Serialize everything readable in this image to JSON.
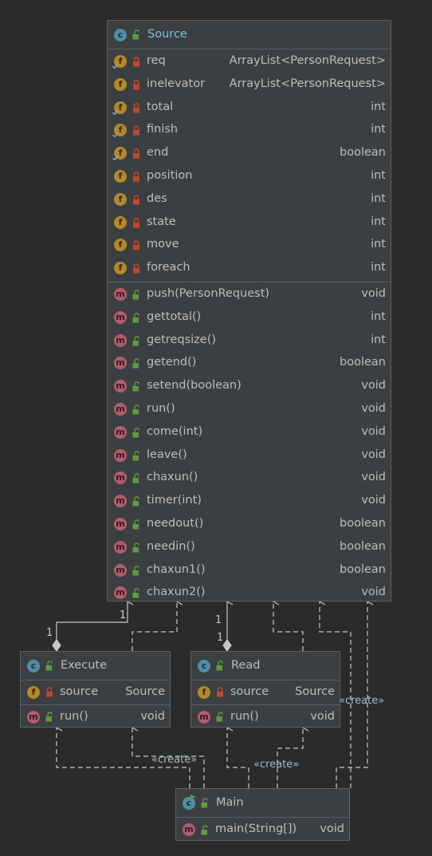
{
  "classes": {
    "source": {
      "title": "Source",
      "fields": [
        {
          "name": "req",
          "type": "ArrayList<PersonRequest>",
          "final": true
        },
        {
          "name": "inelevator",
          "type": "ArrayList<PersonRequest>",
          "final": false
        },
        {
          "name": "total",
          "type": "int",
          "final": true
        },
        {
          "name": "finish",
          "type": "int",
          "final": true
        },
        {
          "name": "end",
          "type": "boolean",
          "final": true
        },
        {
          "name": "position",
          "type": "int",
          "final": false
        },
        {
          "name": "des",
          "type": "int",
          "final": false
        },
        {
          "name": "state",
          "type": "int",
          "final": false
        },
        {
          "name": "move",
          "type": "int",
          "final": false
        },
        {
          "name": "foreach",
          "type": "int",
          "final": false
        }
      ],
      "methods": [
        {
          "name": "push(PersonRequest)",
          "type": "void"
        },
        {
          "name": "gettotal()",
          "type": "int"
        },
        {
          "name": "getreqsize()",
          "type": "int"
        },
        {
          "name": "getend()",
          "type": "boolean"
        },
        {
          "name": "setend(boolean)",
          "type": "void"
        },
        {
          "name": "run()",
          "type": "void"
        },
        {
          "name": "come(int)",
          "type": "void"
        },
        {
          "name": "leave()",
          "type": "void"
        },
        {
          "name": "chaxun()",
          "type": "void"
        },
        {
          "name": "timer(int)",
          "type": "void"
        },
        {
          "name": "needout()",
          "type": "boolean"
        },
        {
          "name": "needin()",
          "type": "boolean"
        },
        {
          "name": "chaxun1()",
          "type": "boolean"
        },
        {
          "name": "chaxun2()",
          "type": "void"
        }
      ]
    },
    "execute": {
      "title": "Execute",
      "fields": [
        {
          "name": "source",
          "type": "Source"
        }
      ],
      "methods": [
        {
          "name": "run()",
          "type": "void"
        }
      ]
    },
    "read": {
      "title": "Read",
      "fields": [
        {
          "name": "source",
          "type": "Source"
        }
      ],
      "methods": [
        {
          "name": "run()",
          "type": "void"
        }
      ]
    },
    "main": {
      "title": "Main",
      "methods": [
        {
          "name": "main(String[])",
          "type": "void"
        }
      ]
    }
  },
  "badges": {
    "class": "c",
    "field": "f",
    "method": "m"
  },
  "labels": {
    "create_read": "«create»",
    "create_execute": "«create»",
    "create_main": "«create»",
    "mult_execute_src": "1",
    "mult_execute_tgt": "1",
    "mult_read_src": "1",
    "mult_read_tgt": "1"
  },
  "colors": {
    "background": "#2b2b2b",
    "class_fill": "#3c3f41",
    "border": "#5e6164",
    "class_badge": "#4e8fa8",
    "field_badge": "#b3882b",
    "method_badge": "#b05d6f",
    "lock_private": "#c0492c",
    "lock_public": "#5f9b3d",
    "edge": "#c8c8c8"
  }
}
